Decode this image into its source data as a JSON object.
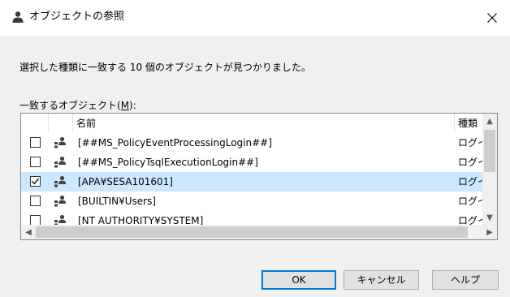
{
  "dialog": {
    "title": "オブジェクトの参照",
    "message": "選択した種類に一致する 10 個のオブジェクトが見つかりました。",
    "list_label": "一致するオブジェクト(",
    "list_label_mnemonic": "M",
    "list_label_end": "):"
  },
  "list": {
    "columns": {
      "name": "名前",
      "type": "種類"
    },
    "rows": [
      {
        "name": "[##MS_PolicyEventProcessingLogin##]",
        "type": "ログイン",
        "checked": false,
        "selected": false
      },
      {
        "name": "[##MS_PolicyTsqlExecutionLogin##]",
        "type": "ログイン",
        "checked": false,
        "selected": false
      },
      {
        "name": "[APA¥SESA101601]",
        "type": "ログイン",
        "checked": true,
        "selected": true
      },
      {
        "name": "[BUILTIN¥Users]",
        "type": "ログイン",
        "checked": false,
        "selected": false
      },
      {
        "name": "[NT AUTHORITY¥SYSTEM]",
        "type": "ログイン",
        "checked": false,
        "selected": false
      }
    ]
  },
  "buttons": {
    "ok": "OK",
    "cancel": "キャンセル",
    "help": "ヘルプ"
  },
  "icons": {
    "title": "user-icon",
    "row": "login-icon",
    "close": "close-icon"
  },
  "colors": {
    "selection": "#cce8ff",
    "default_button_border": "#0078d7",
    "window_bg": "#f0f0f0"
  }
}
